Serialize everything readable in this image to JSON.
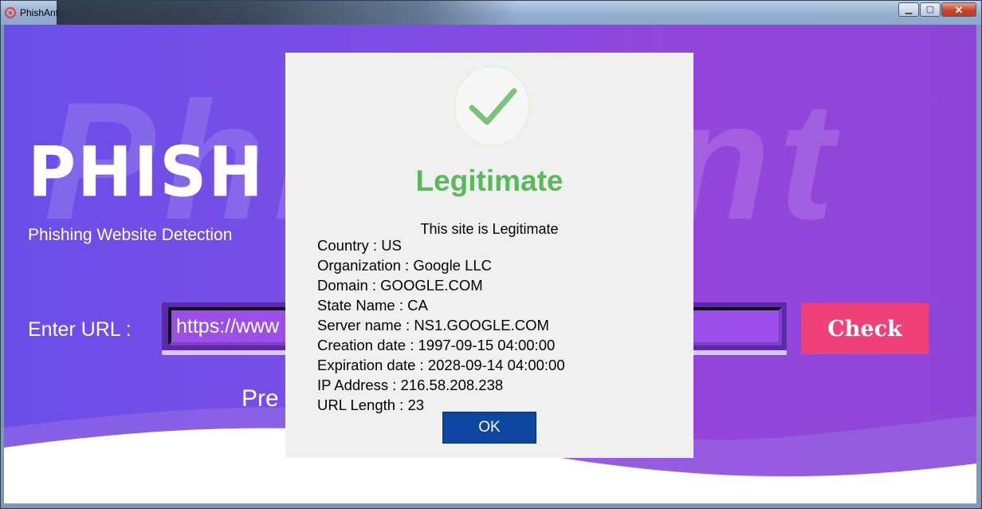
{
  "window": {
    "title": "PhishAnt",
    "buttons": {
      "minimize": "▁",
      "maximize": "▢",
      "close": "✕"
    }
  },
  "app": {
    "watermark": "PhishAnt",
    "brand": "PHISH A",
    "tagline": "Phishing Website Detection",
    "url_label": "Enter URL :",
    "url_value": "https://www",
    "check_label": "Check",
    "prediction_partial": "Pre"
  },
  "modal": {
    "icon": "check-icon",
    "title": "Legitimate",
    "subtitle": "This site is Legitimate",
    "details": [
      "Country : US",
      "Organization : Google LLC",
      "Domain : GOOGLE.COM",
      "State Name : CA",
      "Server name : NS1.GOOGLE.COM",
      "Creation date : 1997-09-15 04:00:00",
      "Expiration date : 2028-09-14 04:00:00",
      "IP Address : 216.58.208.238",
      "URL Length : 23"
    ],
    "ok_label": "OK"
  },
  "colors": {
    "legit_green": "#5cb85c",
    "check_button": "#f0407a",
    "ok_button": "#0d47a1",
    "background_start": "#6a4ee8",
    "background_end": "#8e46d8"
  }
}
